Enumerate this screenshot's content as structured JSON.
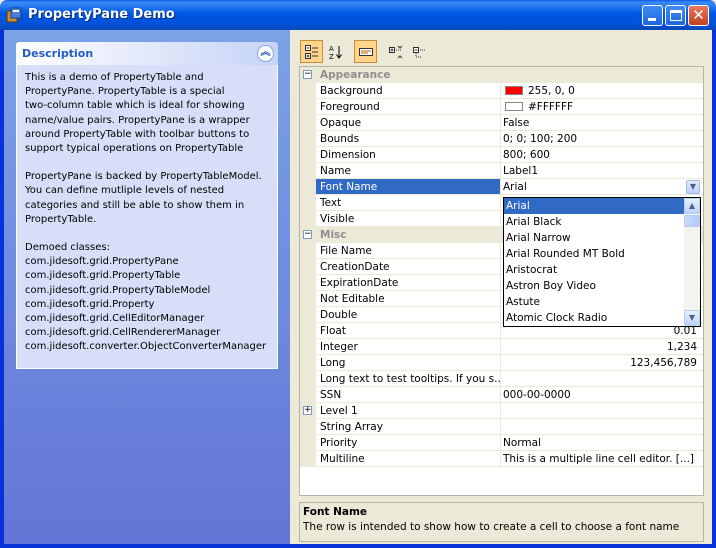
{
  "window": {
    "title": "PropertyPane Demo"
  },
  "description_panel": {
    "title": "Description",
    "paragraphs": [
      "This is a demo of PropertyTable and\nPropertyPane. PropertyTable is a special\ntwo-column table which is ideal for showing\nname/value pairs. PropertyPane is a wrapper\naround PropertyTable with toolbar buttons to\nsupport typical operations on PropertyTable",
      "PropertyPane is backed by PropertyTableModel.\nYou can define mutliple levels of nested\ncategories and still be able to show them in\nPropertyTable.",
      "Demoed classes:\ncom.jidesoft.grid.PropertyPane\ncom.jidesoft.grid.PropertyTable\ncom.jidesoft.grid.PropertyTableModel\ncom.jidesoft.grid.Property\ncom.jidesoft.grid.CellEditorManager\ncom.jidesoft.grid.CellRendererManager\ncom.jidesoft.converter.ObjectConverterManager"
    ]
  },
  "toolbar": {
    "buttons": [
      {
        "icon": "categorized-view-icon",
        "active": true
      },
      {
        "icon": "sort-alphabetical-icon",
        "active": false
      },
      {
        "icon": "description-toggle-icon",
        "active": true
      },
      {
        "icon": "expand-all-icon",
        "active": false
      },
      {
        "icon": "collapse-all-icon",
        "active": false
      }
    ]
  },
  "property_table": {
    "rows": [
      {
        "type": "category",
        "name": "Appearance",
        "expanded": true
      },
      {
        "name": "Background",
        "value": "255, 0, 0",
        "swatch": "#ff0000"
      },
      {
        "name": "Foreground",
        "value": "#FFFFFF",
        "swatch": "#ffffff"
      },
      {
        "name": "Opaque",
        "value": "False"
      },
      {
        "name": "Bounds",
        "value": "0; 0; 100; 200"
      },
      {
        "name": "Dimension",
        "value": "800; 600"
      },
      {
        "name": "Name",
        "value": "Label1"
      },
      {
        "name": "Font Name",
        "value": "Arial",
        "selected": true
      },
      {
        "name": "Text",
        "value": ""
      },
      {
        "name": "Visible",
        "value": ""
      },
      {
        "type": "category",
        "name": "Misc",
        "expanded": true
      },
      {
        "name": "File Name",
        "value": ""
      },
      {
        "name": "CreationDate",
        "value": ""
      },
      {
        "name": "ExpirationDate",
        "value": ""
      },
      {
        "name": "Not Editable",
        "value": ""
      },
      {
        "name": "Double",
        "value": ""
      },
      {
        "name": "Float",
        "value": "0.01",
        "align": "right"
      },
      {
        "name": "Integer",
        "value": "1,234",
        "align": "right"
      },
      {
        "name": "Long",
        "value": "123,456,789",
        "align": "right"
      },
      {
        "name": "Long text to test tooltips. If you s...",
        "value": ""
      },
      {
        "name": "SSN",
        "value": "000-00-0000"
      },
      {
        "name": "Level 1",
        "value": "",
        "expandable": true
      },
      {
        "name": "String Array",
        "value": ""
      },
      {
        "name": "Priority",
        "value": "Normal"
      },
      {
        "name": "Multiline",
        "value": "This is a multiple line cell editor.  [...]"
      }
    ]
  },
  "font_dropdown": {
    "options": [
      "Arial",
      "Arial Black",
      "Arial Narrow",
      "Arial Rounded MT Bold",
      "Aristocrat",
      "Astron Boy Video",
      "Astute",
      "Atomic Clock Radio"
    ],
    "selected": "Arial"
  },
  "info": {
    "title": "Font Name",
    "text": "The row is intended to show how to create a cell to choose a font name"
  },
  "colors": {
    "selection": "#316ac5",
    "titlebar": "#0054e3",
    "pane_background": "#6d8ee0"
  }
}
